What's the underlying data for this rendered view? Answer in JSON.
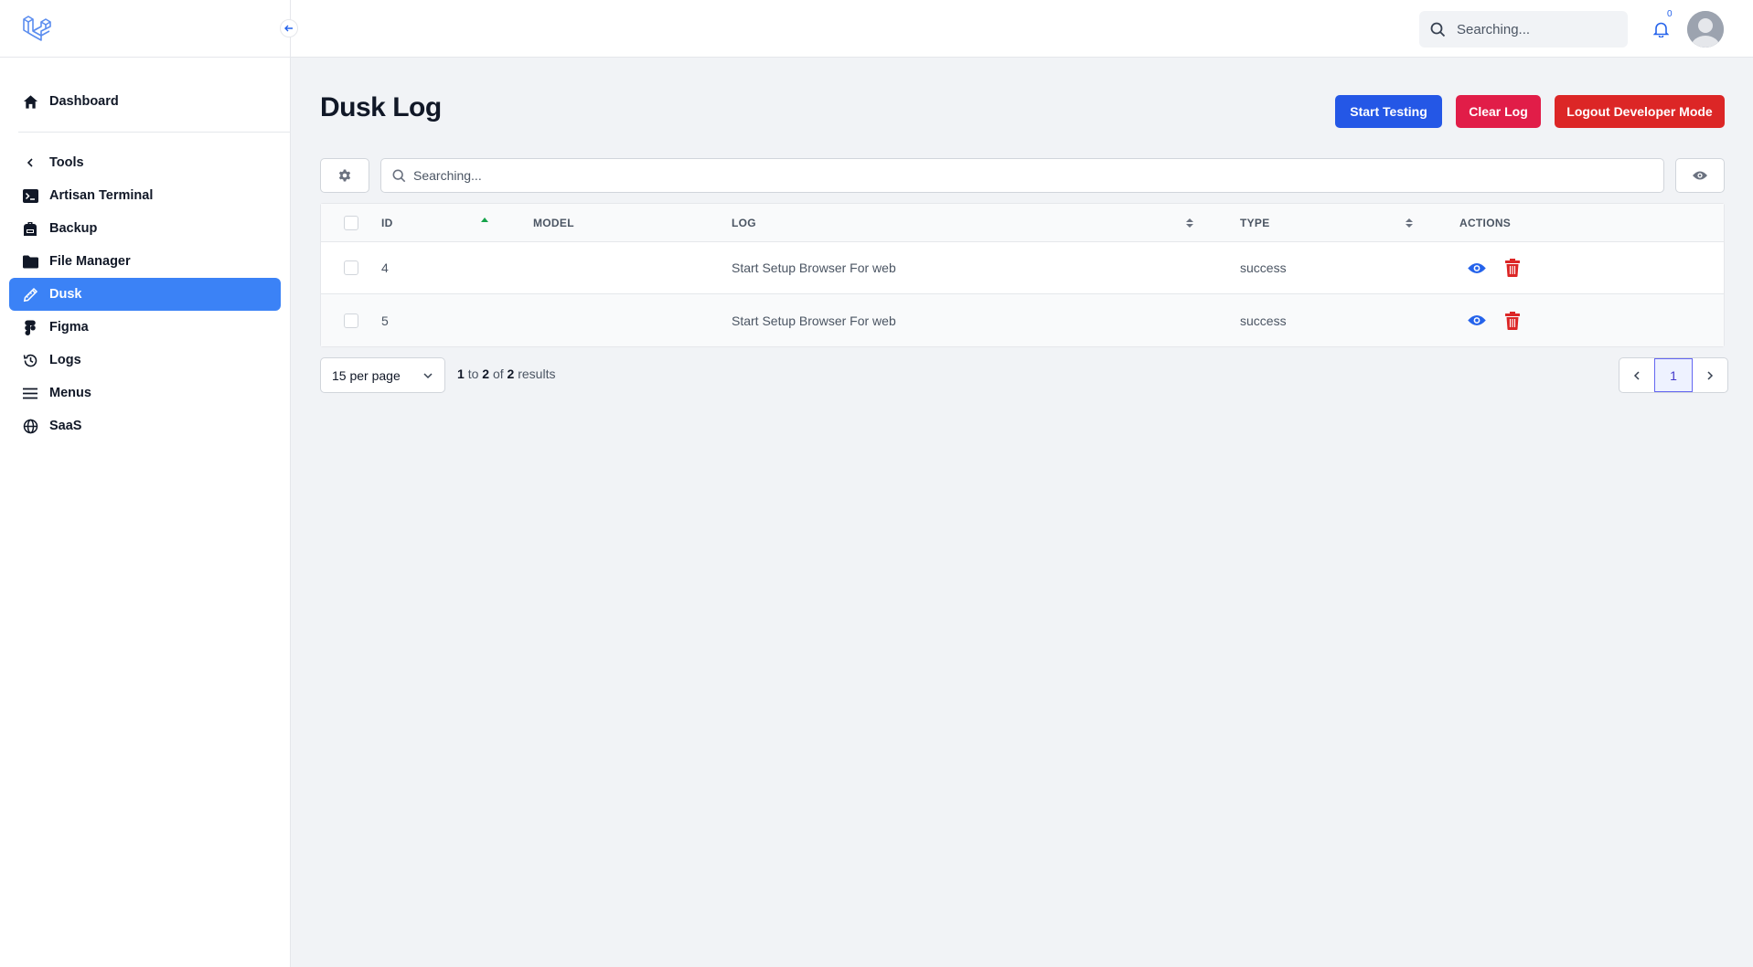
{
  "topbar": {
    "search_placeholder": "Searching...",
    "notification_count": "0"
  },
  "sidebar": {
    "dashboard": "Dashboard",
    "group_label": "Tools",
    "items": [
      {
        "label": "Artisan Terminal",
        "icon": "terminal-icon"
      },
      {
        "label": "Backup",
        "icon": "backpack-icon"
      },
      {
        "label": "File Manager",
        "icon": "folder-icon"
      },
      {
        "label": "Dusk",
        "icon": "pencil-ruler-icon",
        "active": true
      },
      {
        "label": "Figma",
        "icon": "figma-icon"
      },
      {
        "label": "Logs",
        "icon": "history-icon"
      },
      {
        "label": "Menus",
        "icon": "bars-icon"
      },
      {
        "label": "SaaS",
        "icon": "globe-icon"
      }
    ]
  },
  "page": {
    "title": "Dusk Log",
    "buttons": {
      "start_testing": "Start Testing",
      "clear_log": "Clear Log",
      "logout_dev": "Logout Developer Mode"
    },
    "search_placeholder": "Searching..."
  },
  "table": {
    "columns": [
      "ID",
      "MODEL",
      "LOG",
      "TYPE",
      "ACTIONS"
    ],
    "rows": [
      {
        "id": "4",
        "model": "",
        "log": "Start Setup Browser For web",
        "type": "success"
      },
      {
        "id": "5",
        "model": "",
        "log": "Start Setup Browser For web",
        "type": "success"
      }
    ]
  },
  "pagination": {
    "per_page": "15 per page",
    "from": "1",
    "to_word": "to",
    "to": "2",
    "of_word": "of",
    "total": "2",
    "results_word": "results",
    "current_page": "1"
  },
  "colors": {
    "primary": "#2457e6",
    "active_nav": "#3b82f6",
    "danger": "#dc2626",
    "danger_alt": "#e11d48"
  }
}
